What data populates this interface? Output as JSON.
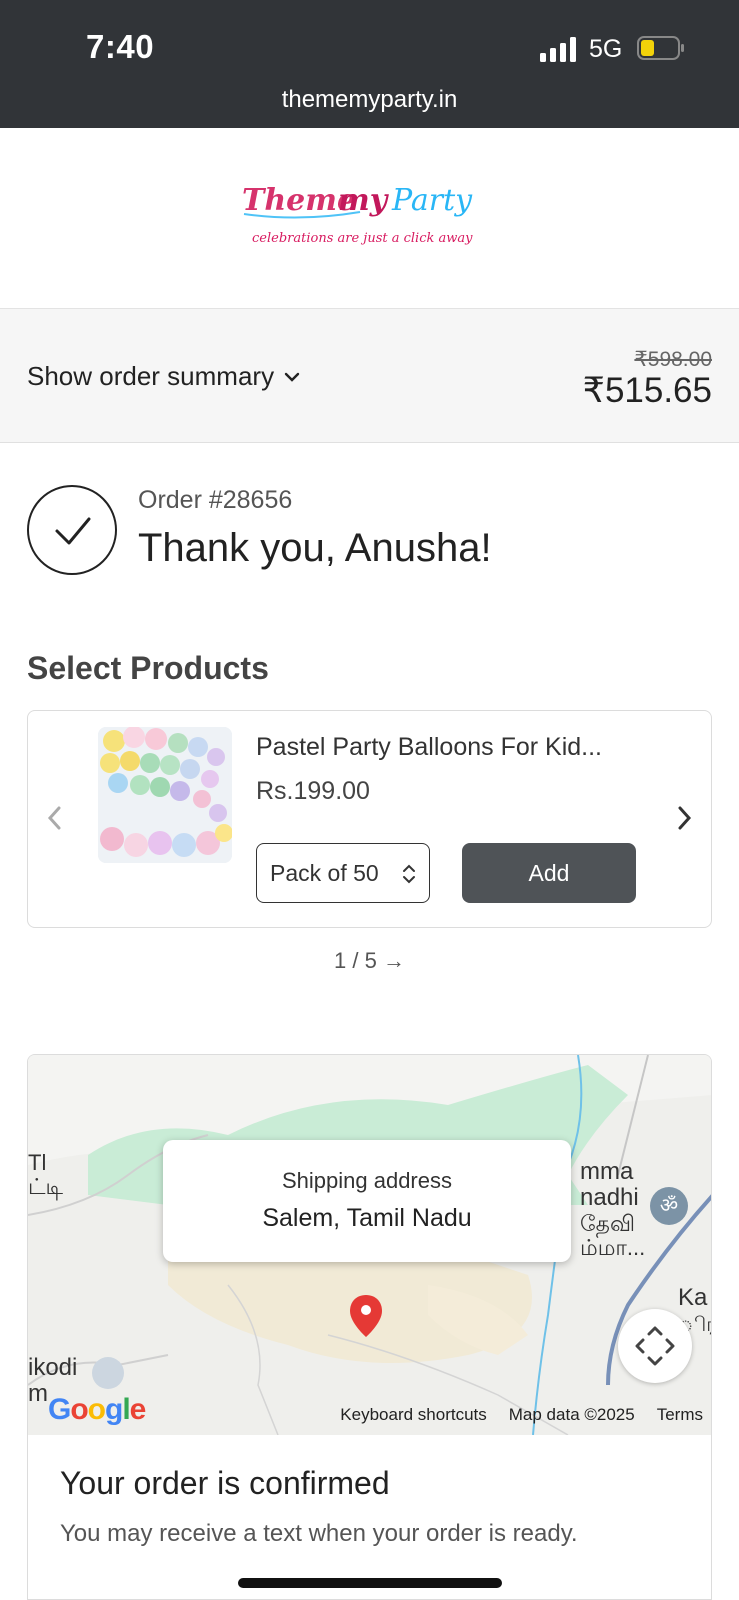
{
  "status_bar": {
    "time": "7:40",
    "network": "5G",
    "url": "thememyparty.in"
  },
  "brand": {
    "name": "Theme my Party",
    "tagline": "celebrations are just a click away"
  },
  "order_summary": {
    "toggle_label": "Show order summary",
    "original_price": "₹598.00",
    "total_price": "₹515.65"
  },
  "order": {
    "number": "Order #28656",
    "thank_you": "Thank you, Anusha!"
  },
  "products": {
    "title": "Select Products",
    "item": {
      "name": "Pastel Party Balloons For Kid...",
      "price": "Rs.199.00",
      "variant": "Pack of 50",
      "add_label": "Add"
    },
    "pager": "1 / 5 →"
  },
  "map": {
    "popup_label": "Shipping address",
    "popup_address": "Salem, Tamil Nadu",
    "labels": [
      "Tl",
      "ட்டி",
      "mma",
      "nadhi",
      "தேவி",
      "ம்மா...",
      "Ka",
      "ிரச",
      "ikodi",
      "m"
    ],
    "footer": [
      "Keyboard shortcuts",
      "Map data ©2025",
      "Terms"
    ],
    "google": "Google"
  },
  "confirmation": {
    "title": "Your order is confirmed",
    "text": "You may receive a text when your order is ready."
  },
  "colors": {
    "status_bar": "#313438",
    "button": "#4f5357",
    "pin": "#e53935",
    "park": "#c9ecd6"
  }
}
